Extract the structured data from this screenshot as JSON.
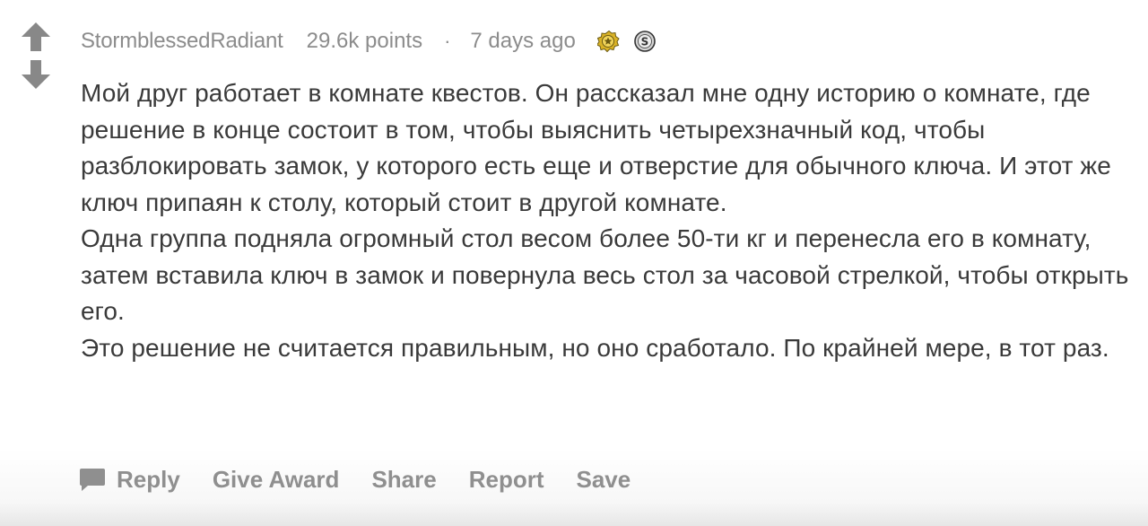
{
  "comment": {
    "author": "StormblessedRadiant",
    "points": "29.6k points",
    "separator": "·",
    "time": "7 days ago",
    "awards": [
      "silver-award-icon",
      "award-s-icon"
    ],
    "paragraphs": [
      "Мой друг работает в комнате квестов. Он рассказал мне одну историю о комнате, где решение в конце состоит в том, чтобы выяснить четырехзначный код, чтобы разблокировать замок, у которого есть еще и отверстие для обычного ключа. И этот же ключ припаян к столу, который стоит в другой комнате.",
      "Одна группа подняла огромный стол весом более 50-ти кг и перенесла его в комнату, затем вставила ключ в замок и повернула весь стол за часовой стрелкой, чтобы открыть его.",
      "Это решение не считается правильным, но оно сработало. По крайней мере, в тот раз."
    ]
  },
  "actions": {
    "reply": "Reply",
    "give_award": "Give Award",
    "share": "Share",
    "report": "Report",
    "save": "Save"
  },
  "colors": {
    "muted_text": "#8c8c8c",
    "body_text": "#3a3a3a",
    "arrow": "#888888",
    "action_text": "#8f8f8f"
  }
}
